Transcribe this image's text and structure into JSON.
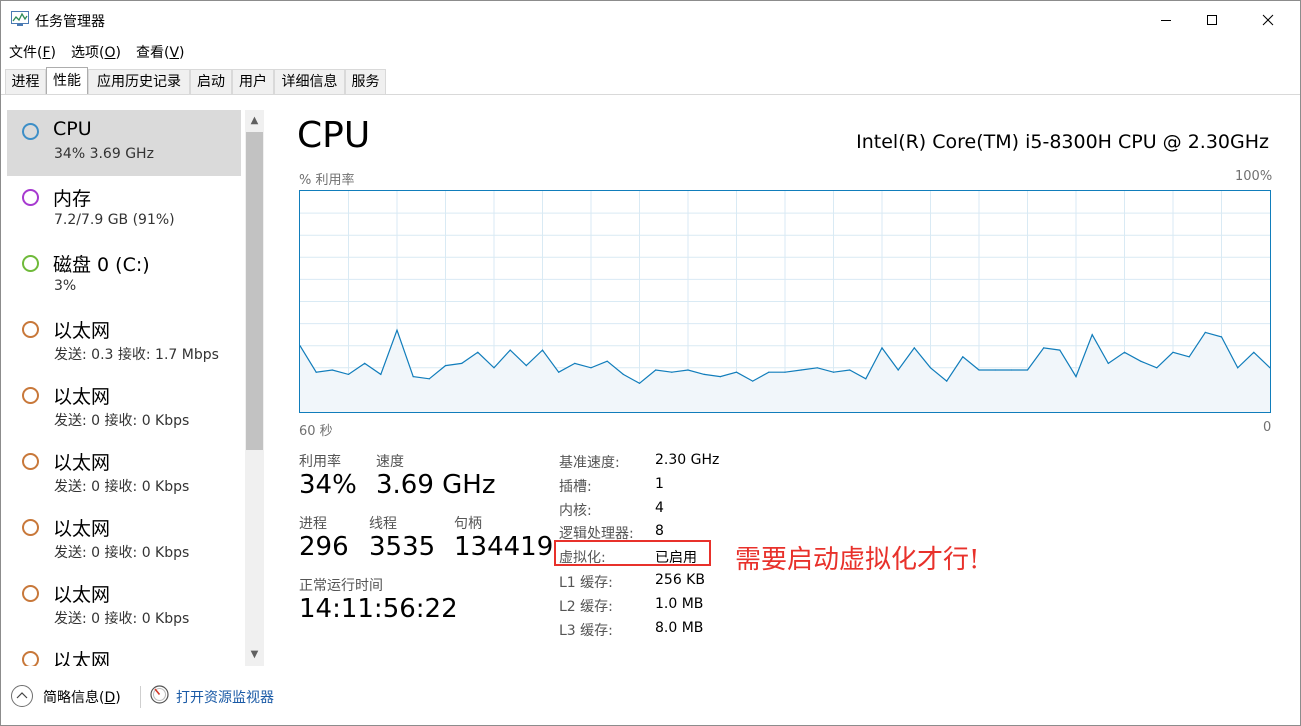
{
  "window": {
    "title": "任务管理器",
    "icon": "task-manager-icon"
  },
  "menu": [
    {
      "label": "文件",
      "key": "F"
    },
    {
      "label": "选项",
      "key": "O"
    },
    {
      "label": "查看",
      "key": "V"
    }
  ],
  "tabs": [
    "进程",
    "性能",
    "应用历史记录",
    "启动",
    "用户",
    "详细信息",
    "服务"
  ],
  "active_tab": "性能",
  "resources": [
    {
      "name": "CPU",
      "detail": "34% 3.69 GHz",
      "color": "#3c8ec7",
      "selected": true
    },
    {
      "name": "内存",
      "detail": "7.2/7.9 GB (91%)",
      "color": "#a73ad0"
    },
    {
      "name": "磁盘 0 (C:)",
      "detail": "3%",
      "color": "#6fba3a"
    },
    {
      "name": "以太网",
      "detail": "发送: 0.3 接收: 1.7 Mbps",
      "color": "#c8783a"
    },
    {
      "name": "以太网",
      "detail": "发送: 0 接收: 0 Kbps",
      "color": "#c8783a"
    },
    {
      "name": "以太网",
      "detail": "发送: 0 接收: 0 Kbps",
      "color": "#c8783a"
    },
    {
      "name": "以太网",
      "detail": "发送: 0 接收: 0 Kbps",
      "color": "#c8783a"
    },
    {
      "name": "以太网",
      "detail": "发送: 0 接收: 0 Kbps",
      "color": "#c8783a"
    },
    {
      "name": "以太网",
      "detail": "",
      "color": "#c8783a"
    }
  ],
  "main": {
    "title": "CPU",
    "model": "Intel(R) Core(TM) i5-8300H CPU @ 2.30GHz"
  },
  "chart_data": {
    "type": "area",
    "ylabel": "% 利用率",
    "ymax_label": "100%",
    "xstart_label": "60 秒",
    "xend_label": "0",
    "ylim": [
      0,
      100
    ],
    "x_seconds_ago": [
      60,
      59,
      58,
      57,
      56,
      55,
      54,
      53,
      52,
      51,
      50,
      49,
      48,
      47,
      46,
      45,
      44,
      43,
      42,
      41,
      40,
      39,
      38,
      37,
      36,
      35,
      34,
      33,
      32,
      31,
      30,
      29,
      28,
      27,
      26,
      25,
      24,
      23,
      22,
      21,
      20,
      19,
      18,
      17,
      16,
      15,
      14,
      13,
      12,
      11,
      10,
      9,
      8,
      7,
      6,
      5,
      4,
      3,
      2,
      1,
      0
    ],
    "values": [
      30,
      18,
      19,
      17,
      22,
      17,
      37,
      16,
      15,
      21,
      22,
      27,
      20,
      28,
      21,
      28,
      18,
      22,
      20,
      23,
      17,
      13,
      19,
      18,
      19,
      17,
      16,
      18,
      14,
      18,
      18,
      19,
      20,
      18,
      19,
      15,
      29,
      19,
      29,
      20,
      14,
      25,
      19,
      19,
      19,
      19,
      29,
      28,
      16,
      35,
      22,
      27,
      23,
      20,
      27,
      25,
      36,
      34,
      20,
      27,
      20
    ],
    "line_color": "#117dbb",
    "fill_color": "#f1f6fa",
    "grid_color": "#d9eaf4",
    "grid": true
  },
  "stats": {
    "utilization_label": "利用率",
    "utilization_value": "34%",
    "speed_label": "速度",
    "speed_value": "3.69 GHz",
    "processes_label": "进程",
    "processes_value": "296",
    "threads_label": "线程",
    "threads_value": "3535",
    "handles_label": "句柄",
    "handles_value": "134419",
    "uptime_label": "正常运行时间",
    "uptime_value": "14:11:56:22"
  },
  "specs": [
    {
      "label": "基准速度:",
      "value": "2.30 GHz"
    },
    {
      "label": "插槽:",
      "value": "1"
    },
    {
      "label": "内核:",
      "value": "4"
    },
    {
      "label": "逻辑处理器:",
      "value": "8"
    },
    {
      "label": "虚拟化:",
      "value": "已启用"
    },
    {
      "label": "L1 缓存:",
      "value": "256 KB"
    },
    {
      "label": "L2 缓存:",
      "value": "1.0 MB"
    },
    {
      "label": "L3 缓存:",
      "value": "8.0 MB"
    }
  ],
  "annotation": {
    "text": "需要启动虚拟化才行!",
    "color": "#e8312b"
  },
  "footer": {
    "fewer_details_label": "简略信息",
    "fewer_details_key": "D",
    "resource_monitor_link": "打开资源监视器"
  }
}
